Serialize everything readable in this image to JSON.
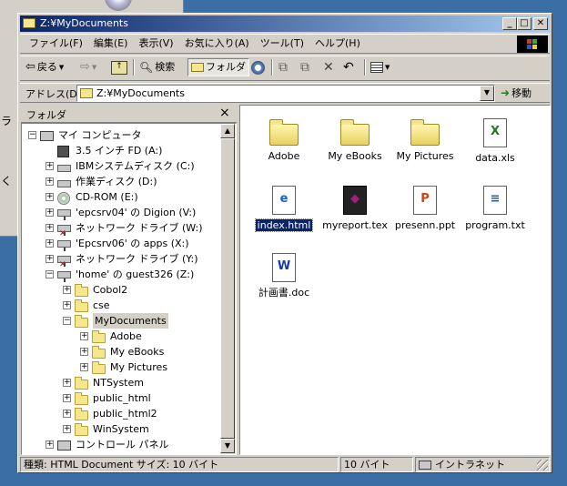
{
  "window": {
    "title": "Z:¥MyDocuments"
  },
  "menu": [
    "ファイル(F)",
    "編集(E)",
    "表示(V)",
    "お気に入り(A)",
    "ツール(T)",
    "ヘルプ(H)"
  ],
  "toolbar": {
    "back_label": "戻る",
    "search_label": "検索",
    "folders_label": "フォルダ"
  },
  "address": {
    "label": "アドレス(D)",
    "value": "Z:¥MyDocuments",
    "go_label": "移動"
  },
  "folder_pane": {
    "title": "フォルダ",
    "close": "×"
  },
  "tree": [
    {
      "label": "マイ コンピュータ",
      "icon": "computer-icon",
      "pm": "−"
    },
    {
      "label": "3.5 インチ FD (A:)",
      "icon": "floppy-drive-icon",
      "pm": ""
    },
    {
      "label": "IBMシステムディスク (C:)",
      "icon": "hard-drive-icon",
      "pm": "+"
    },
    {
      "label": "作業ディスク (D:)",
      "icon": "hard-drive-icon",
      "pm": "+"
    },
    {
      "label": "CD-ROM (E:)",
      "icon": "cd-drive-icon",
      "pm": "+"
    },
    {
      "label": "'epcsrv04' の Digion (V:)",
      "icon": "network-drive-icon",
      "pm": "+"
    },
    {
      "label": "ネットワーク ドライブ (W:)",
      "icon": "disconnected-network-drive-icon",
      "pm": "+"
    },
    {
      "label": "'Epcsrv06' の apps (X:)",
      "icon": "network-drive-icon",
      "pm": "+"
    },
    {
      "label": "ネットワーク ドライブ (Y:)",
      "icon": "disconnected-network-drive-icon",
      "pm": "+"
    },
    {
      "label": "'home' の guest326 (Z:)",
      "icon": "network-drive-icon",
      "pm": "−"
    },
    {
      "label": "Cobol2",
      "icon": "folder-icon",
      "pm": "+"
    },
    {
      "label": "cse",
      "icon": "folder-icon",
      "pm": "+"
    },
    {
      "label": "MyDocuments",
      "icon": "open-folder-icon",
      "pm": "−"
    },
    {
      "label": "Adobe",
      "icon": "folder-icon",
      "pm": "+"
    },
    {
      "label": "My eBooks",
      "icon": "folder-icon",
      "pm": "+"
    },
    {
      "label": "My Pictures",
      "icon": "folder-icon",
      "pm": "+"
    },
    {
      "label": "NTSystem",
      "icon": "folder-icon",
      "pm": "+"
    },
    {
      "label": "public_html",
      "icon": "folder-icon",
      "pm": "+"
    },
    {
      "label": "public_html2",
      "icon": "folder-icon",
      "pm": "+"
    },
    {
      "label": "WinSystem",
      "icon": "folder-icon",
      "pm": "+"
    },
    {
      "label": "コントロール パネル",
      "icon": "control-panel-icon",
      "pm": "+"
    }
  ],
  "files": [
    {
      "label": "Adobe",
      "icon": "folder-icon"
    },
    {
      "label": "My eBooks",
      "icon": "folder-icon"
    },
    {
      "label": "My Pictures",
      "icon": "folder-icon"
    },
    {
      "label": "data.xls",
      "icon": "excel-file-icon"
    },
    {
      "label": "index.html",
      "icon": "html-file-icon"
    },
    {
      "label": "myreport.tex",
      "icon": "tex-file-icon"
    },
    {
      "label": "presenn.ppt",
      "icon": "powerpoint-file-icon"
    },
    {
      "label": "program.txt",
      "icon": "text-file-icon"
    },
    {
      "label": "計画書.doc",
      "icon": "word-file-icon"
    }
  ],
  "status": {
    "info": "種類: HTML Document サイズ: 10 バイト",
    "size": "10 バイト",
    "zone": "イントラネット"
  },
  "background": {
    "left_text": "ラ\nく"
  }
}
